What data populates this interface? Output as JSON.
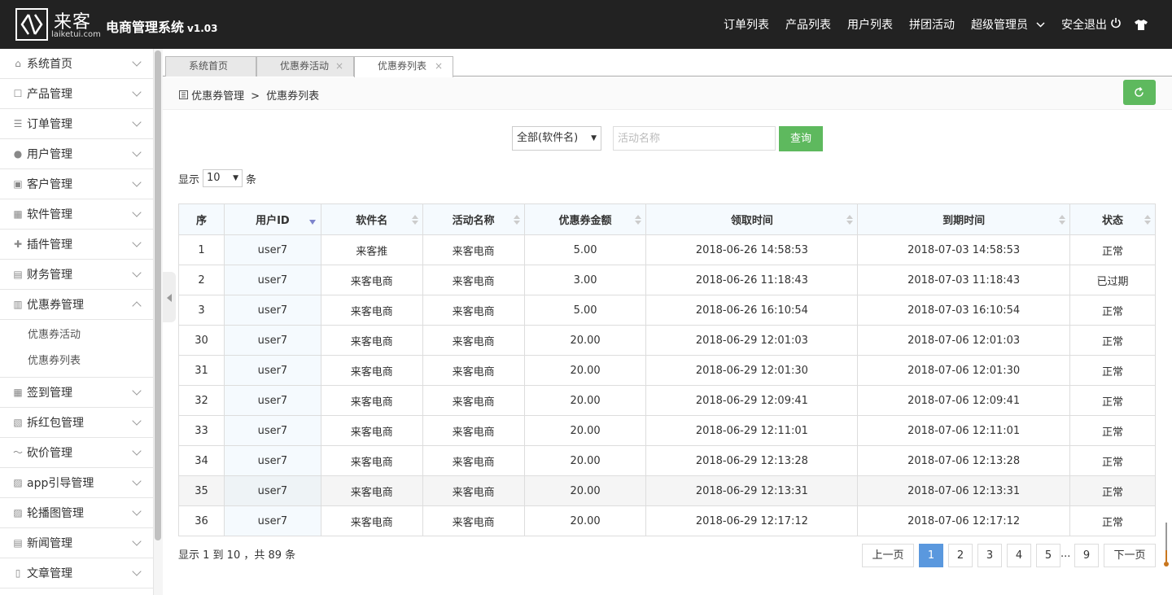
{
  "header": {
    "logo_cn": "来客",
    "logo_en": "laiketui.com",
    "title": "电商管理系统",
    "version": "v1.03",
    "nav": [
      "订单列表",
      "产品列表",
      "用户列表",
      "拼团活动"
    ],
    "admin": "超级管理员",
    "logout": "安全退出"
  },
  "sidebar": {
    "items": [
      {
        "label": "系统首页",
        "icon": "home-icon"
      },
      {
        "label": "产品管理",
        "icon": "bag-icon"
      },
      {
        "label": "订单管理",
        "icon": "list-icon"
      },
      {
        "label": "用户管理",
        "icon": "user-icon"
      },
      {
        "label": "客户管理",
        "icon": "customer-icon"
      },
      {
        "label": "软件管理",
        "icon": "grid-icon"
      },
      {
        "label": "插件管理",
        "icon": "puzzle-icon"
      },
      {
        "label": "财务管理",
        "icon": "finance-icon"
      },
      {
        "label": "优惠券管理",
        "icon": "coupon-icon"
      },
      {
        "label": "签到管理",
        "icon": "calendar-icon"
      },
      {
        "label": "拆红包管理",
        "icon": "redpacket-icon"
      },
      {
        "label": "砍价管理",
        "icon": "bargain-icon"
      },
      {
        "label": "app引导管理",
        "icon": "image-icon"
      },
      {
        "label": "轮播图管理",
        "icon": "image-icon"
      },
      {
        "label": "新闻管理",
        "icon": "news-icon"
      },
      {
        "label": "文章管理",
        "icon": "doc-icon"
      }
    ],
    "sub": [
      "优惠券活动",
      "优惠券列表"
    ]
  },
  "tabs": [
    "系统首页",
    "优惠券活动",
    "优惠券列表"
  ],
  "breadcrumb": {
    "parent": "优惠券管理",
    "sep": ">",
    "current": "优惠券列表"
  },
  "filter": {
    "select_value": "全部(软件名)",
    "placeholder": "活动名称",
    "search_label": "查询"
  },
  "length": {
    "prefix": "显示",
    "value": "10",
    "suffix": "条"
  },
  "table": {
    "headers": [
      "序",
      "用户ID",
      "软件名",
      "活动名称",
      "优惠券金额",
      "领取时间",
      "到期时间",
      "状态"
    ],
    "rows": [
      [
        "1",
        "user7",
        "来客推",
        "来客电商",
        "5.00",
        "2018-06-26 14:58:53",
        "2018-07-03 14:58:53",
        "正常"
      ],
      [
        "2",
        "user7",
        "来客电商",
        "来客电商",
        "3.00",
        "2018-06-26 11:18:43",
        "2018-07-03 11:18:43",
        "已过期"
      ],
      [
        "3",
        "user7",
        "来客电商",
        "来客电商",
        "5.00",
        "2018-06-26 16:10:54",
        "2018-07-03 16:10:54",
        "正常"
      ],
      [
        "30",
        "user7",
        "来客电商",
        "来客电商",
        "20.00",
        "2018-06-29 12:01:03",
        "2018-07-06 12:01:03",
        "正常"
      ],
      [
        "31",
        "user7",
        "来客电商",
        "来客电商",
        "20.00",
        "2018-06-29 12:01:30",
        "2018-07-06 12:01:30",
        "正常"
      ],
      [
        "32",
        "user7",
        "来客电商",
        "来客电商",
        "20.00",
        "2018-06-29 12:09:41",
        "2018-07-06 12:09:41",
        "正常"
      ],
      [
        "33",
        "user7",
        "来客电商",
        "来客电商",
        "20.00",
        "2018-06-29 12:11:01",
        "2018-07-06 12:11:01",
        "正常"
      ],
      [
        "34",
        "user7",
        "来客电商",
        "来客电商",
        "20.00",
        "2018-06-29 12:13:28",
        "2018-07-06 12:13:28",
        "正常"
      ],
      [
        "35",
        "user7",
        "来客电商",
        "来客电商",
        "20.00",
        "2018-06-29 12:13:31",
        "2018-07-06 12:13:31",
        "正常"
      ],
      [
        "36",
        "user7",
        "来客电商",
        "来客电商",
        "20.00",
        "2018-06-29 12:17:12",
        "2018-07-06 12:17:12",
        "正常"
      ]
    ]
  },
  "info": "显示 1 到 10 ，共 89 条",
  "pager": {
    "prev": "上一页",
    "pages": [
      "1",
      "2",
      "3",
      "4",
      "5"
    ],
    "ellipsis": "...",
    "last": "9",
    "next": "下一页"
  },
  "colors": {
    "topbar": "#222222",
    "accent_green": "#5eb95e",
    "pager_active": "#5a98de"
  }
}
